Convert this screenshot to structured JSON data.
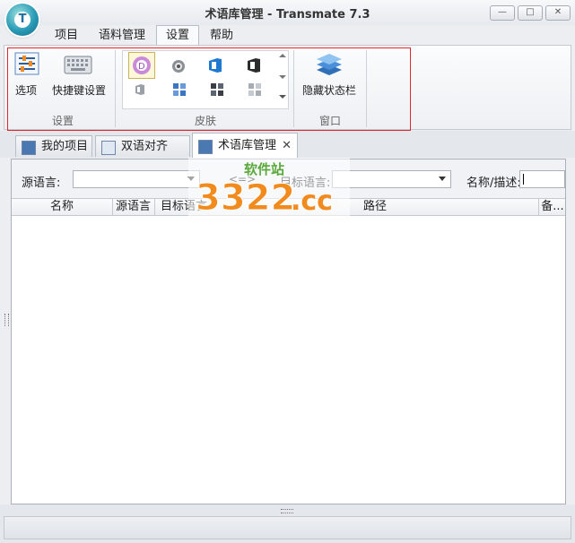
{
  "window": {
    "title": "术语库管理 - Transmate 7.3",
    "logo_letter": "T"
  },
  "menu": {
    "tabs": [
      "项目",
      "语料管理",
      "设置",
      "帮助"
    ],
    "active": "设置"
  },
  "ribbon": {
    "groups": {
      "settings": {
        "label": "设置",
        "options_label": "选项",
        "shortcut_label": "快捷键设置"
      },
      "skin": {
        "label": "皮肤"
      },
      "window": {
        "label": "窗口",
        "hide_status_label": "隐藏状态栏"
      }
    }
  },
  "doc_tabs": [
    {
      "label": "我的项目",
      "active": false
    },
    {
      "label": "双语对齐",
      "active": false
    },
    {
      "label": "术语库管理",
      "active": true
    }
  ],
  "filters": {
    "source_lang_label": "源语言:",
    "target_lang_label": "目标语言:",
    "swap_label": "<=>",
    "name_desc_label": "名称/描述:",
    "source_lang_value": "",
    "target_lang_value": "",
    "name_desc_value": ""
  },
  "table": {
    "columns": [
      "名称",
      "源语言",
      "目标语言",
      "路径",
      "备..."
    ],
    "rows": []
  },
  "watermark": {
    "digits": "3322",
    "suffix": ".cc",
    "top_text": "软件站"
  },
  "colors": {
    "accent_blue": "#1f6fa0",
    "highlight_red": "#e0262d",
    "watermark_orange": "#f28b1d",
    "watermark_green": "#5aa83a"
  }
}
